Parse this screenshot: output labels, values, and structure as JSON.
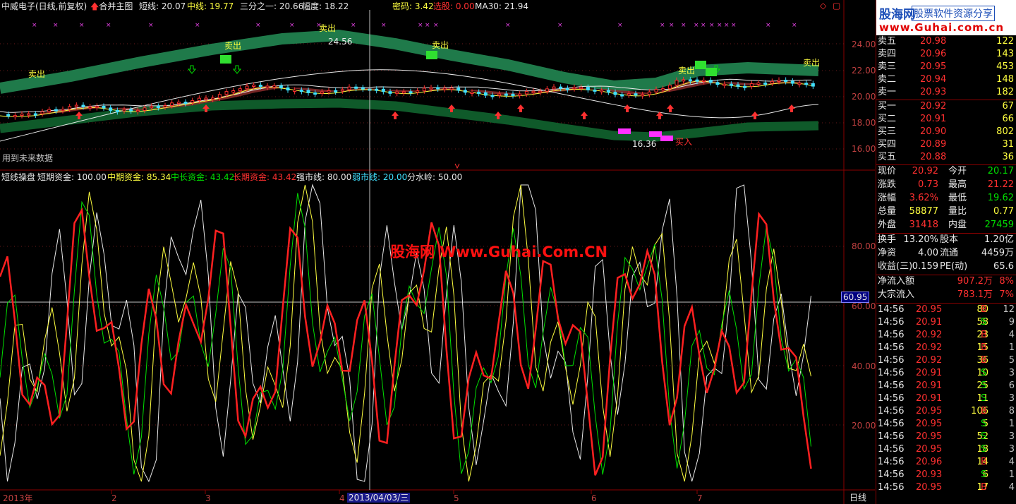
{
  "main_chart": {
    "title": "中威电子(日线,前复权)",
    "merge_label": "合并主图",
    "indicators": [
      {
        "label": "短线: 20.07",
        "color": "#e8e8e8"
      },
      {
        "label": "中线: 19.77",
        "color": "#ffff40"
      },
      {
        "label": "三分之一: 20.66",
        "color": "#e8e8e8"
      },
      {
        "label": "幅度: 18.22",
        "color": "#e8e8e8"
      },
      {
        "label": "密码: 3.42",
        "color": "#ffff40"
      },
      {
        "label": "选股: 0.00",
        "color": "#ff3030"
      },
      {
        "label": "MA30: 21.94",
        "color": "#e8e8e8"
      }
    ],
    "price_ticks": [
      "24.00",
      "22.00",
      "20.00",
      "18.00",
      "16.00"
    ],
    "future_data_note": "用到未来数据",
    "sell_labels": [
      "卖出",
      "卖出",
      "卖出",
      "卖出",
      "卖出",
      "卖出"
    ],
    "buy_label": "买入",
    "high_label": "24.56",
    "low_label": "16.36"
  },
  "sub_chart": {
    "indicators": [
      {
        "label": "短线操盘",
        "color": "#e8e8e8"
      },
      {
        "label": "短期资金: 100.00",
        "color": "#e8e8e8"
      },
      {
        "label": "中期资金: 85.34",
        "color": "#ffff40"
      },
      {
        "label": "中长资金: 43.42",
        "color": "#00e000"
      },
      {
        "label": "长期资金: 43.42",
        "color": "#ff3030"
      },
      {
        "label": "强市线: 80.00",
        "color": "#e8e8e8"
      },
      {
        "label": "弱市线: 20.00",
        "color": "#40e0ff"
      },
      {
        "label": "分水岭: 50.00",
        "color": "#e8e8e8"
      }
    ],
    "ticks": [
      "80.00",
      "60.00",
      "40.00",
      "20.00"
    ],
    "cursor_value": "60.95",
    "watermark": "股海网 Www.Guhai.Com.CN"
  },
  "time_axis": {
    "labels": [
      "2013年",
      "2",
      "3",
      "4",
      "5",
      "6",
      "7"
    ],
    "cursor_date": "2013/04/03/三",
    "period": "日线"
  },
  "logo": {
    "name": "股海网",
    "slogan": "股票软件资源分享",
    "url": "www.Guhai.com.cn"
  },
  "order_book": {
    "asks": [
      {
        "label": "卖五",
        "price": "20.98",
        "vol": "122"
      },
      {
        "label": "卖四",
        "price": "20.96",
        "vol": "143"
      },
      {
        "label": "卖三",
        "price": "20.95",
        "vol": "453"
      },
      {
        "label": "卖二",
        "price": "20.94",
        "vol": "148"
      },
      {
        "label": "卖一",
        "price": "20.93",
        "vol": "182"
      }
    ],
    "bids": [
      {
        "label": "买一",
        "price": "20.92",
        "vol": "67"
      },
      {
        "label": "买二",
        "price": "20.91",
        "vol": "66"
      },
      {
        "label": "买三",
        "price": "20.90",
        "vol": "802"
      },
      {
        "label": "买四",
        "price": "20.89",
        "vol": "31"
      },
      {
        "label": "买五",
        "price": "20.88",
        "vol": "36"
      }
    ]
  },
  "quote": {
    "rows": [
      {
        "l1": "现价",
        "v1": "20.92",
        "c1": "red",
        "l2": "今开",
        "v2": "20.17",
        "c2": "green"
      },
      {
        "l1": "涨跌",
        "v1": "0.73",
        "c1": "red",
        "l2": "最高",
        "v2": "21.22",
        "c2": "red"
      },
      {
        "l1": "涨幅",
        "v1": "3.62%",
        "c1": "red",
        "l2": "最低",
        "v2": "19.62",
        "c2": "green"
      },
      {
        "l1": "总量",
        "v1": "58877",
        "c1": "yellow",
        "l2": "量比",
        "v2": "0.77",
        "c2": "yellow"
      },
      {
        "l1": "外盘",
        "v1": "31418",
        "c1": "red",
        "l2": "内盘",
        "v2": "27459",
        "c2": "green"
      }
    ],
    "rows2": [
      {
        "l1": "换手",
        "v1": "13.20%",
        "c1": "white",
        "l2": "股本",
        "v2": "1.20亿",
        "c2": "white"
      },
      {
        "l1": "净资",
        "v1": "4.00",
        "c1": "white",
        "l2": "流通",
        "v2": "4459万",
        "c2": "white"
      },
      {
        "l1": "收益(三)",
        "v1": "0.159",
        "c1": "white",
        "l2": "PE(动)",
        "v2": "65.6",
        "c2": "white"
      }
    ],
    "flows": [
      {
        "label": "净流入额",
        "value": "907.2万",
        "pct": "8%"
      },
      {
        "label": "大宗流入",
        "value": "783.1万",
        "pct": "7%"
      }
    ]
  },
  "ticks": [
    {
      "time": "14:56",
      "price": "20.95",
      "vol": "80",
      "side": "B",
      "n": "12"
    },
    {
      "time": "14:56",
      "price": "20.91",
      "vol": "58",
      "side": "S",
      "n": "9"
    },
    {
      "time": "14:56",
      "price": "20.92",
      "vol": "23",
      "side": "B",
      "n": "4"
    },
    {
      "time": "14:56",
      "price": "20.92",
      "vol": "15",
      "side": "B",
      "n": "1"
    },
    {
      "time": "14:56",
      "price": "20.92",
      "vol": "36",
      "side": "B",
      "n": "5"
    },
    {
      "time": "14:56",
      "price": "20.91",
      "vol": "10",
      "side": "S",
      "n": "3"
    },
    {
      "time": "14:56",
      "price": "20.91",
      "vol": "25",
      "side": "S",
      "n": "6"
    },
    {
      "time": "14:56",
      "price": "20.91",
      "vol": "11",
      "side": "S",
      "n": "3"
    },
    {
      "time": "14:56",
      "price": "20.95",
      "vol": "106",
      "side": "B",
      "n": "8"
    },
    {
      "time": "14:56",
      "price": "20.95",
      "vol": "5",
      "side": "S",
      "n": "1"
    },
    {
      "time": "14:56",
      "price": "20.95",
      "vol": "52",
      "side": "S",
      "n": "3"
    },
    {
      "time": "14:56",
      "price": "20.95",
      "vol": "18",
      "side": "S",
      "n": "3"
    },
    {
      "time": "14:56",
      "price": "20.96",
      "vol": "14",
      "side": "B",
      "n": "4"
    },
    {
      "time": "14:56",
      "price": "20.93",
      "vol": "6",
      "side": "S",
      "n": "1"
    },
    {
      "time": "14:56",
      "price": "20.95",
      "vol": "17",
      "side": "B",
      "n": "4"
    }
  ]
}
